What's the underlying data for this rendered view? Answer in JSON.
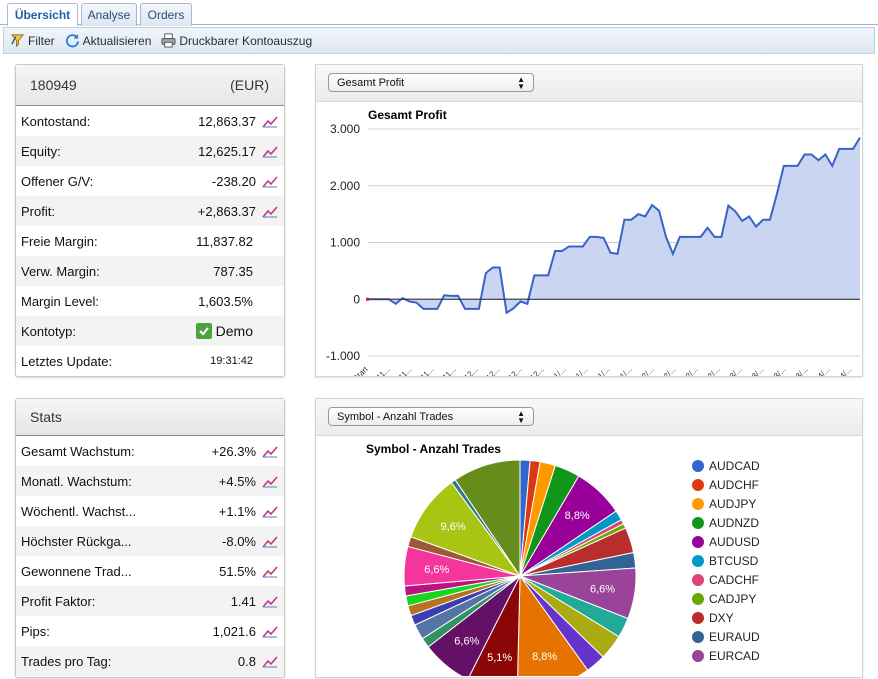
{
  "tabs": [
    {
      "label": "Übersicht",
      "active": true
    },
    {
      "label": "Analyse",
      "active": false
    },
    {
      "label": "Orders",
      "active": false
    }
  ],
  "toolbar": {
    "filter": "Filter",
    "refresh": "Aktualisieren",
    "print": "Druckbarer Kontoauszug"
  },
  "account": {
    "number": "180949",
    "currency": "(EUR)",
    "rows": [
      {
        "label": "Kontostand:",
        "value": "12,863.37",
        "tone": "normal",
        "icon": true
      },
      {
        "label": "Equity:",
        "value": "12,625.17",
        "tone": "normal",
        "icon": true
      },
      {
        "label": "Offener G/V:",
        "value": "-238.20",
        "tone": "neg",
        "icon": true
      },
      {
        "label": "Profit:",
        "value": "+2,863.37",
        "tone": "pos",
        "icon": true
      },
      {
        "label": "Freie Margin:",
        "value": "11,837.82",
        "tone": "normal",
        "icon": false
      },
      {
        "label": "Verw. Margin:",
        "value": "787.35",
        "tone": "normal",
        "icon": false
      },
      {
        "label": "Margin Level:",
        "value": "1,603.5%",
        "tone": "normal",
        "icon": false
      },
      {
        "label": "Kontotyp:",
        "value": "Demo",
        "tone": "normal",
        "icon": false
      },
      {
        "label": "Letztes Update:",
        "value": "19:31:42",
        "tone": "normal",
        "icon": false
      }
    ]
  },
  "stats": {
    "title": "Stats",
    "rows": [
      {
        "label": "Gesamt Wachstum:",
        "value": "+26.3%",
        "tone": "pos"
      },
      {
        "label": "Monatl. Wachstum:",
        "value": "+4.5%",
        "tone": "pos"
      },
      {
        "label": "Wöchentl. Wachst...",
        "value": "+1.1%",
        "tone": "pos"
      },
      {
        "label": "Höchster Rückga...",
        "value": "-8.0%",
        "tone": "neg"
      },
      {
        "label": "Gewonnene Trad...",
        "value": "51.5%",
        "tone": "pos"
      },
      {
        "label": "Profit Faktor:",
        "value": "1.41",
        "tone": "pos"
      },
      {
        "label": "Pips:",
        "value": "1,021.6",
        "tone": "normal"
      },
      {
        "label": "Trades pro Tag:",
        "value": "0.8",
        "tone": "normal"
      }
    ]
  },
  "profit_select": "Gesamt Profit",
  "symbol_select": "Symbol - Anzahl Trades",
  "colors": {
    "accent": "#1f5fa8",
    "area": "#c6d3f0",
    "line": "#3a63c8",
    "pos": "#2c8a20",
    "neg": "#c0282a"
  },
  "chart_data": [
    {
      "type": "area",
      "title": "Gesamt Profit",
      "ylim": [
        -1000,
        3000
      ],
      "ytick_labels": [
        "3.000",
        "2.000",
        "1.000",
        "0",
        "-1.000"
      ],
      "yticks": [
        3000,
        2000,
        1000,
        0,
        -1000
      ],
      "grid": true,
      "xtick_labels": [
        "Start",
        "11...",
        "11...",
        "11...",
        "11...",
        "12...",
        "12...",
        "12...",
        "12...",
        "1/...",
        "1/...",
        "1/...",
        "1/...",
        "2/...",
        "2/...",
        "2/...",
        "2/...",
        "3/...",
        "3/...",
        "3/...",
        "3/...",
        "4/...",
        "4/..."
      ],
      "values": [
        0,
        0,
        0,
        0,
        -80,
        20,
        -40,
        -60,
        -170,
        -170,
        -170,
        70,
        60,
        60,
        -170,
        -170,
        -170,
        460,
        560,
        560,
        -240,
        -160,
        -40,
        -80,
        420,
        420,
        420,
        850,
        850,
        930,
        930,
        930,
        1100,
        1100,
        1080,
        820,
        800,
        1400,
        1400,
        1500,
        1460,
        1660,
        1560,
        1100,
        800,
        1100,
        1100,
        1100,
        1100,
        1260,
        1100,
        1100,
        1650,
        1550,
        1380,
        1460,
        1280,
        1400,
        1400,
        1850,
        2350,
        2350,
        2350,
        2550,
        2550,
        2450,
        2550,
        2350,
        2650,
        2650,
        2650,
        2850
      ]
    },
    {
      "type": "pie",
      "title": "Symbol - Anzahl Trades",
      "legend": [
        "AUDCAD",
        "AUDCHF",
        "AUDJPY",
        "AUDNZD",
        "AUDUSD",
        "BTCUSD",
        "CADCHF",
        "CADJPY",
        "DXY",
        "EURAUD",
        "EURCAD"
      ],
      "slices": [
        {
          "label": "AUDCAD",
          "value": 1.3,
          "color": "#3366cc"
        },
        {
          "label": "AUDCHF",
          "value": 1.3,
          "color": "#dc3912"
        },
        {
          "label": "AUDJPY",
          "value": 2.0,
          "color": "#ff9900"
        },
        {
          "label": "AUDNZD",
          "value": 3.3,
          "color": "#109618"
        },
        {
          "label": "AUDUSD",
          "value": 6.6,
          "color": "#990099"
        },
        {
          "label": "BTCUSD",
          "value": 1.3,
          "color": "#0099c6"
        },
        {
          "label": "CADCHF",
          "value": 0.6,
          "color": "#dd4477"
        },
        {
          "label": "CADJPY",
          "value": 0.6,
          "color": "#66aa00"
        },
        {
          "label": "DXY",
          "value": 3.3,
          "color": "#b82e2e"
        },
        {
          "label": "EURAUD",
          "value": 2.0,
          "color": "#316395"
        },
        {
          "label": "EURCAD",
          "value": 6.6,
          "color": "#994499"
        },
        {
          "label": "",
          "value": 2.6,
          "color": "#22aa99"
        },
        {
          "label": "",
          "value": 3.3,
          "color": "#aaaa11"
        },
        {
          "label": "",
          "value": 2.6,
          "color": "#6633cc"
        },
        {
          "label": "",
          "value": 9.6,
          "color": "#e67300"
        },
        {
          "label": "",
          "value": 6.6,
          "color": "#8b0707"
        },
        {
          "label": "",
          "value": 6.6,
          "color": "#651067"
        },
        {
          "label": "",
          "value": 1.3,
          "color": "#329262"
        },
        {
          "label": "",
          "value": 2.0,
          "color": "#5574a6"
        },
        {
          "label": "",
          "value": 1.3,
          "color": "#3b3eac"
        },
        {
          "label": "",
          "value": 1.3,
          "color": "#b77322"
        },
        {
          "label": "",
          "value": 1.3,
          "color": "#16d620"
        },
        {
          "label": "",
          "value": 1.3,
          "color": "#b91383"
        },
        {
          "label": "",
          "value": 5.1,
          "color": "#f4359e"
        },
        {
          "label": "",
          "value": 1.3,
          "color": "#9c5935"
        },
        {
          "label": "",
          "value": 8.8,
          "color": "#a9c413"
        },
        {
          "label": "",
          "value": 0.6,
          "color": "#2a778d"
        },
        {
          "label": "",
          "value": 8.8,
          "color": "#668d1c"
        }
      ],
      "value_labels": [
        "8,8%",
        "6,6%",
        "8,8%",
        "5,1%",
        "6,6%",
        "6,6%",
        "9,6%"
      ]
    }
  ]
}
